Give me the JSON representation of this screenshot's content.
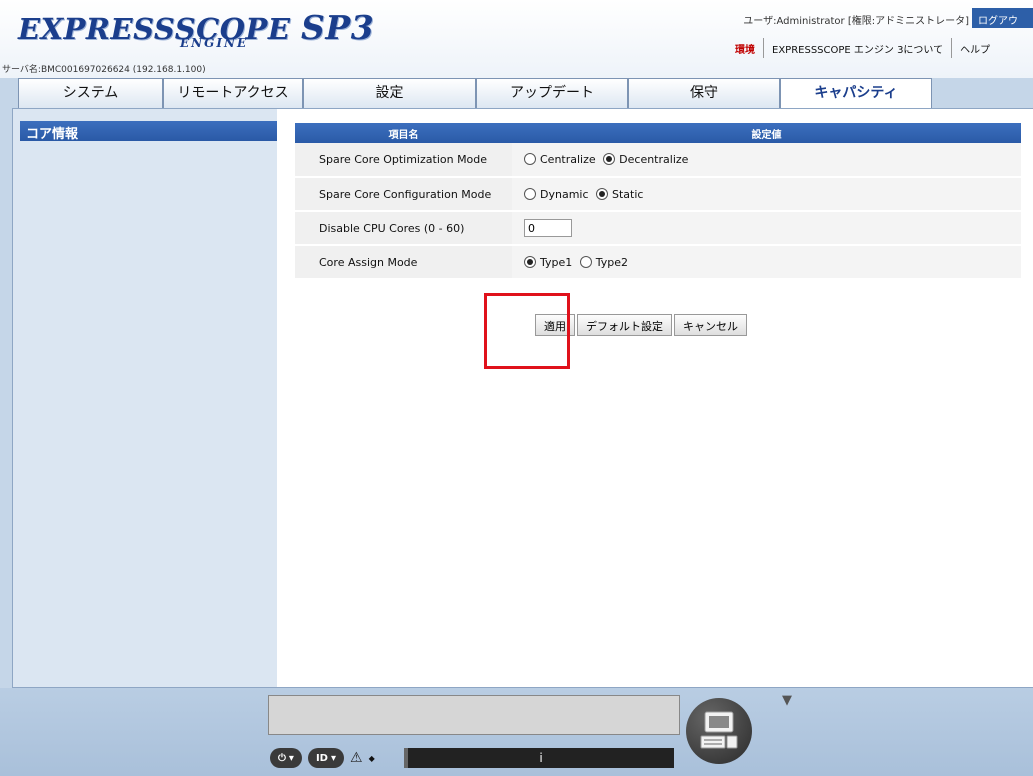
{
  "header": {
    "logo_main": "EXPRESSSCOPE",
    "logo_sp3": "SP3",
    "logo_sub": "ENGINE",
    "server_name": "サーバ名:BMC001697026624 (192.168.1.100)",
    "user_info": "ユーザ:Administrator [権限:アドミニストレータ]",
    "logout": "ログアウ",
    "nav": [
      "環境",
      "EXPRESSSCOPE エンジン 3について",
      "ヘルプ"
    ]
  },
  "tabs": [
    {
      "label": "システム",
      "active": false
    },
    {
      "label": "リモートアクセス",
      "active": false
    },
    {
      "label": "設定",
      "active": false
    },
    {
      "label": "アップデート",
      "active": false
    },
    {
      "label": "保守",
      "active": false
    },
    {
      "label": "キャパシティ",
      "active": true
    }
  ],
  "sidebar": {
    "heading": "コア情報"
  },
  "table": {
    "col_name": "項目名",
    "col_value": "設定値",
    "rows": [
      {
        "label": "Spare Core Optimization Mode",
        "options": [
          "Centralize",
          "Decentralize"
        ],
        "selected": 1
      },
      {
        "label": "Spare Core Configuration Mode",
        "options": [
          "Dynamic",
          "Static"
        ],
        "selected": 1
      },
      {
        "label": "Disable CPU Cores (0 - 60)",
        "input_value": "0"
      },
      {
        "label": "Core Assign Mode",
        "options": [
          "Type1",
          "Type2"
        ],
        "selected": 0
      }
    ]
  },
  "buttons": {
    "apply": "適用",
    "default": "デフォルト設定",
    "cancel": "キャンセル"
  },
  "footer": {
    "power_label": "⏻",
    "id_label": "ID",
    "warning_icon": "⚠",
    "status_text": "i"
  },
  "colors": {
    "brand_blue": "#1b3e8c",
    "header_blue": "#2a59a6",
    "highlight_red": "#e0111b"
  }
}
